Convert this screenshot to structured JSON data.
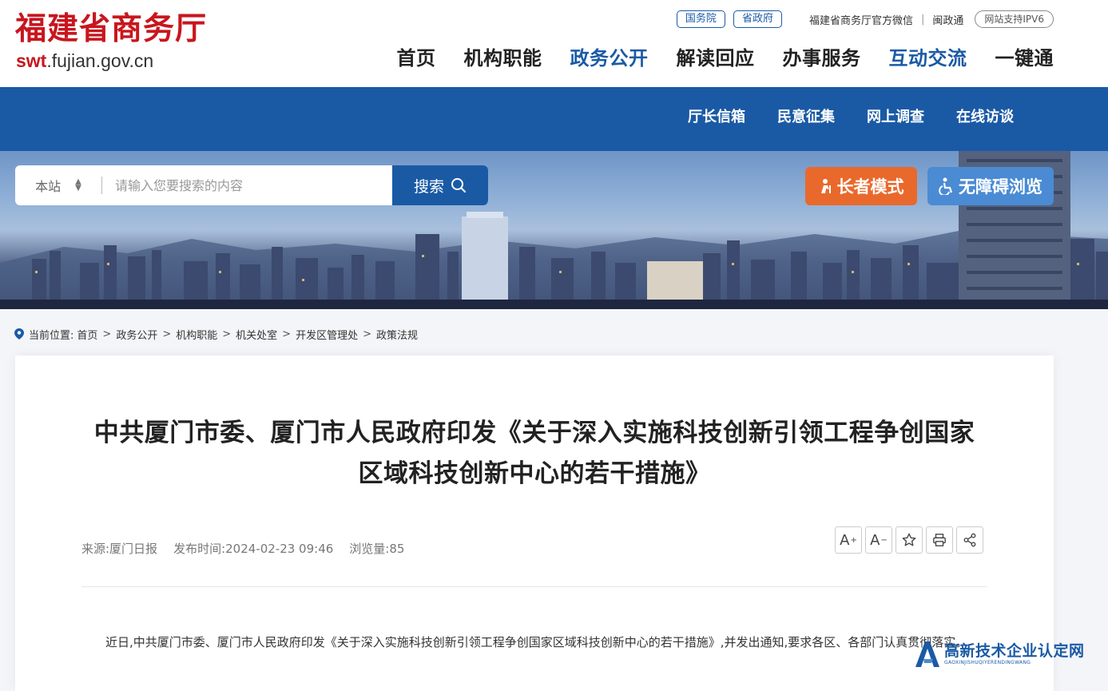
{
  "header": {
    "logo_title": "福建省商务厅",
    "logo_url_prefix": "swt",
    "logo_url_suffix": ".fujian.gov.cn",
    "top_links": {
      "state_council": "国务院",
      "province_gov": "省政府",
      "wechat": "福建省商务厅官方微信",
      "separator": "|",
      "minzhengtong": "闽政通",
      "ipv6": "网站支持IPV6"
    },
    "main_nav": [
      {
        "label": "首页",
        "active": false
      },
      {
        "label": "机构职能",
        "active": false
      },
      {
        "label": "政务公开",
        "active": true
      },
      {
        "label": "解读回应",
        "active": false
      },
      {
        "label": "办事服务",
        "active": false
      },
      {
        "label": "互动交流",
        "active": true
      },
      {
        "label": "一键通",
        "active": false
      }
    ]
  },
  "subnav": [
    "厅长信箱",
    "民意征集",
    "网上调查",
    "在线访谈"
  ],
  "search": {
    "scope": "本站",
    "placeholder": "请输入您要搜索的内容",
    "button": "搜索"
  },
  "accessibility": {
    "elder_mode": "长者模式",
    "barrier_free": "无障碍浏览"
  },
  "breadcrumb": {
    "label": "当前位置:",
    "items": [
      "首页",
      "政务公开",
      "机构职能",
      "机关处室",
      "开发区管理处",
      "政策法规"
    ],
    "separator": ">"
  },
  "article": {
    "title_line1": "中共厦门市委、厦门市人民政府印发《关于深入实施科技创新引领工程争创国家",
    "title_line2": "区域科技创新中心的若干措施》",
    "source": "来源:厦门日报",
    "publish_time": "发布时间:2024-02-23 09:46",
    "views": "浏览量:85",
    "body": "近日,中共厦门市委、厦门市人民政府印发《关于深入实施科技创新引领工程争创国家区域科技创新中心的若干措施》,并发出通知,要求各区、各部门认真贯彻落实。"
  },
  "tools": {
    "font_larger": "A",
    "font_larger_sup": "+",
    "font_smaller": "A",
    "font_smaller_sup": "−"
  },
  "watermark": {
    "main": "高新技术企业认定网",
    "sub": "GAOXINJISHUQIYERENDINGWANG"
  },
  "colors": {
    "brand_red": "#c8161e",
    "brand_blue": "#1a5aa5",
    "elder_orange": "#e9692c",
    "access_blue": "#4a8bd4"
  }
}
